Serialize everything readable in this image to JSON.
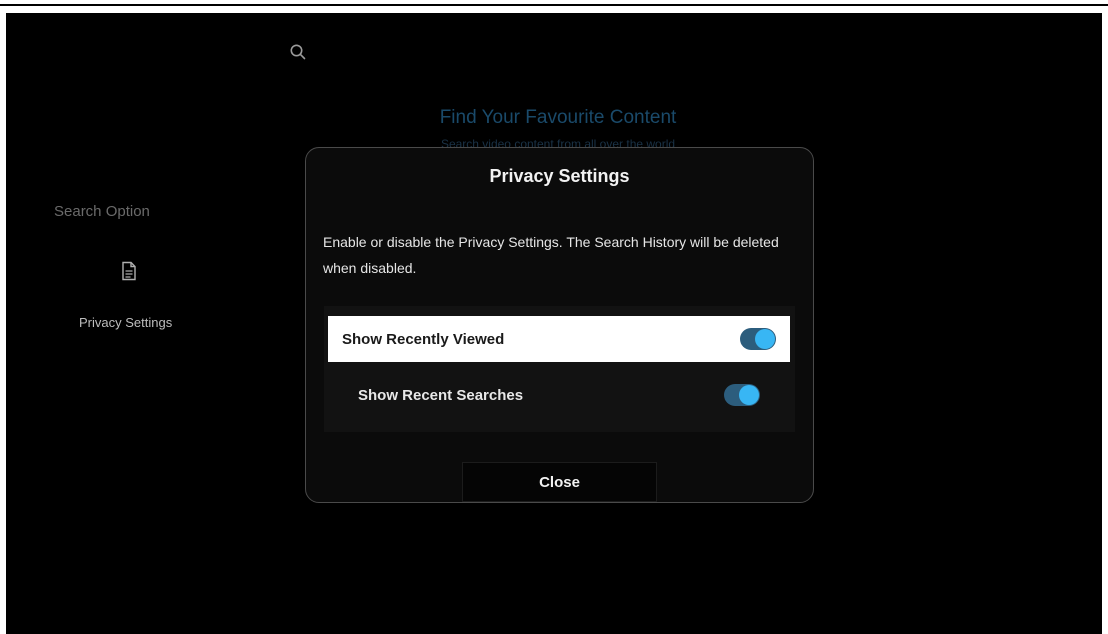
{
  "background": {
    "heading": "Find Your Favourite Content",
    "subheading": "Search video content from all over the world"
  },
  "sidebar": {
    "section_label": "Search Option",
    "item_label": "Privacy Settings"
  },
  "dialog": {
    "title": "Privacy Settings",
    "description": "Enable or disable the Privacy Settings. The Search History will be deleted when disabled.",
    "options": [
      {
        "label": "Show Recently Viewed",
        "enabled": true,
        "focused": true
      },
      {
        "label": "Show Recent Searches",
        "enabled": true,
        "focused": false
      }
    ],
    "close_label": "Close"
  },
  "colors": {
    "toggle_on_track": "#2c5d7d",
    "toggle_on_knob": "#38b6f4",
    "accent_heading": "#1a4a6a"
  }
}
